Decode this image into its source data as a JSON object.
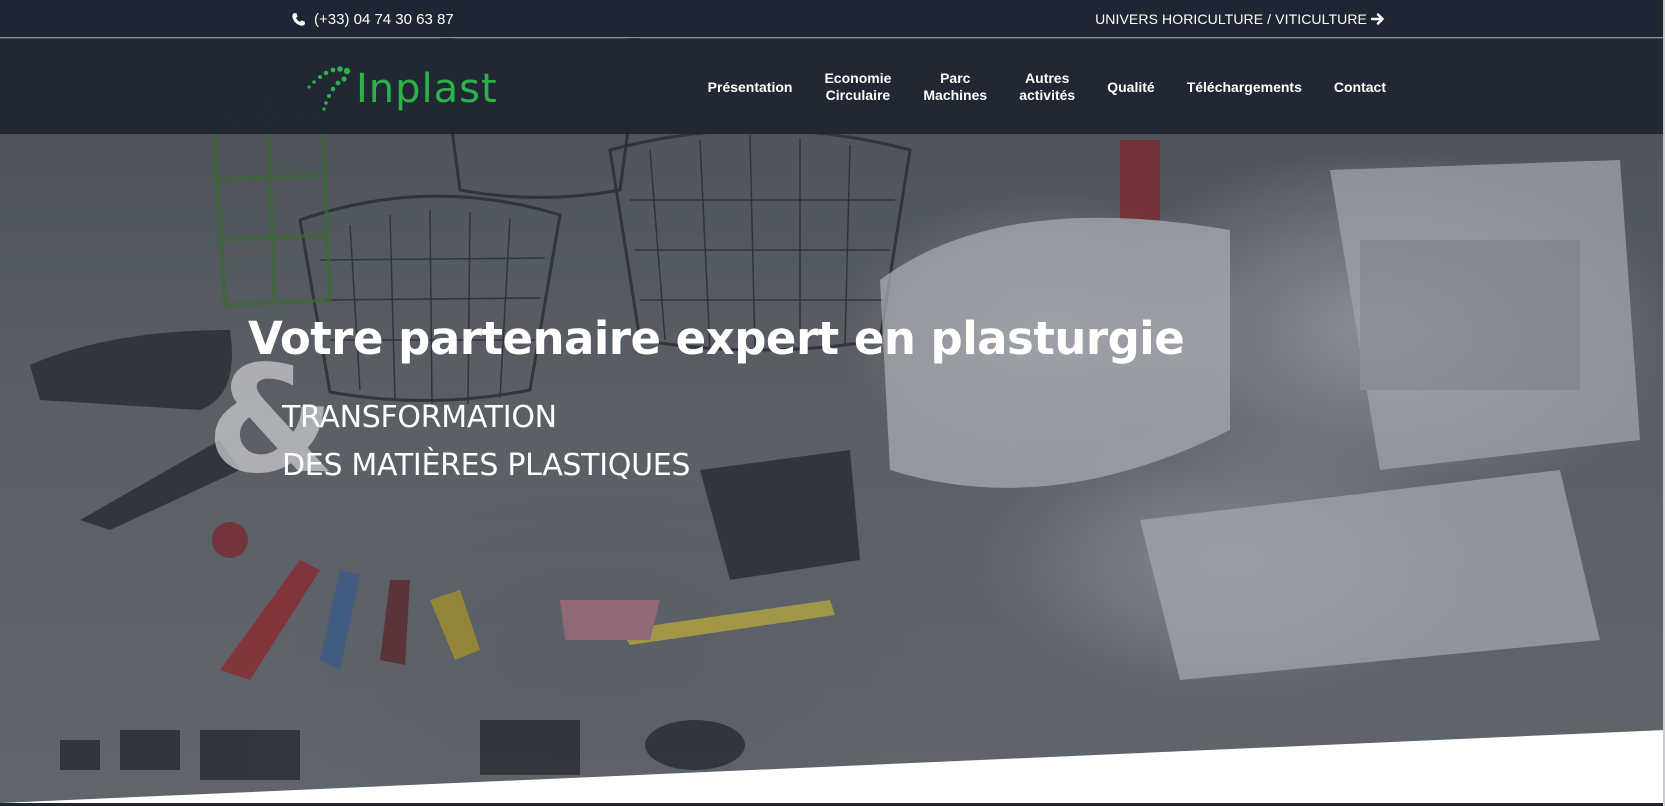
{
  "topbar": {
    "phone": "(+33) 04 74 30 63 87",
    "phone_icon": "phone-icon",
    "univers_link": "UNIVERS HORICULTURE / VITICULTURE",
    "arrow_icon": "arrow-right-icon"
  },
  "logo": {
    "text": "Inplast",
    "color": "#2bb34a"
  },
  "nav": {
    "items": [
      {
        "line1": "Présentation",
        "line2": ""
      },
      {
        "line1": "Economie",
        "line2": "Circulaire"
      },
      {
        "line1": "Parc",
        "line2": "Machines"
      },
      {
        "line1": "Autres",
        "line2": "activités"
      },
      {
        "line1": "Qualité",
        "line2": ""
      },
      {
        "line1": "Téléchargements",
        "line2": ""
      },
      {
        "line1": "Contact",
        "line2": ""
      }
    ]
  },
  "hero": {
    "headline": "Votre partenaire expert en plasturgie",
    "ampersand": "&",
    "subline1": "TRANSFORMATION",
    "subline2": "DES MATIÈRES PLASTIQUES"
  },
  "colors": {
    "header_bg": "#1f2633",
    "accent": "#2bb34a"
  }
}
